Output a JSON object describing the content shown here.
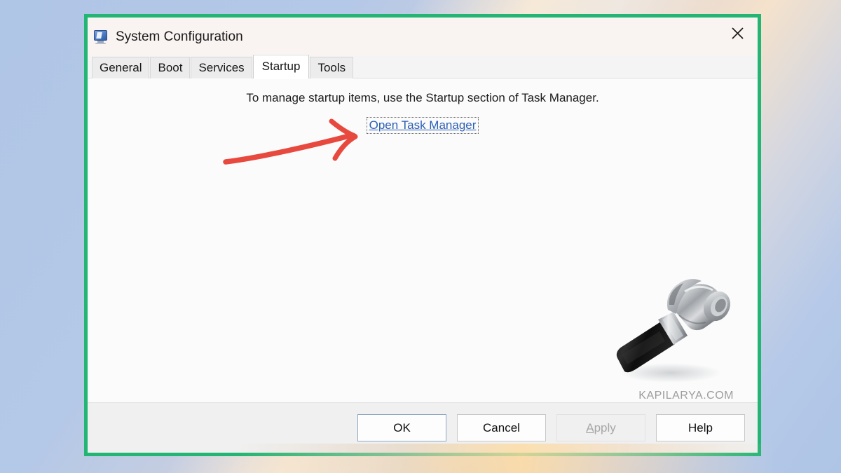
{
  "window": {
    "title": "System Configuration",
    "icon": "system-configuration-icon",
    "close_label": "✕"
  },
  "tabs": [
    {
      "label": "General",
      "selected": false
    },
    {
      "label": "Boot",
      "selected": false
    },
    {
      "label": "Services",
      "selected": false
    },
    {
      "label": "Startup",
      "selected": true
    },
    {
      "label": "Tools",
      "selected": false
    }
  ],
  "panel": {
    "note": "To manage startup items, use the Startup section of Task Manager.",
    "link_label": "Open Task Manager",
    "illustration": "hammer-icon",
    "watermark": "KAPILARYA.COM"
  },
  "footer": {
    "buttons": [
      {
        "label": "OK",
        "state": "default"
      },
      {
        "label": "Cancel",
        "state": "normal"
      },
      {
        "label": "Apply",
        "state": "disabled"
      },
      {
        "label": "Help",
        "state": "normal"
      }
    ]
  },
  "annotation": {
    "arrow": "red-arrow-pointing-right",
    "arrow_color": "#e8493f"
  },
  "colors": {
    "highlight_frame": "#22b573",
    "link": "#2c5fb5",
    "default_button_border": "#8fa8c4",
    "desktop_blue": "#b0c6e6",
    "desktop_peach": "#f4e2cc"
  }
}
